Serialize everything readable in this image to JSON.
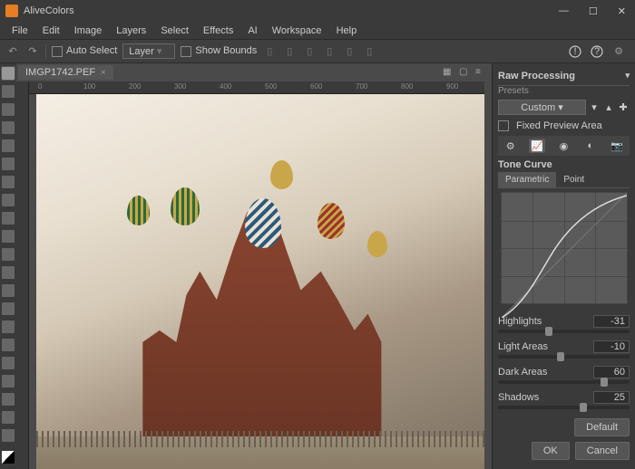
{
  "app": {
    "title": "AliveColors"
  },
  "menu": {
    "items": [
      "File",
      "Edit",
      "Image",
      "Layers",
      "Select",
      "Effects",
      "AI",
      "Workspace",
      "Help"
    ]
  },
  "toolbar": {
    "undo": "↶",
    "redo": "↷",
    "auto_select": "Auto Select",
    "layer_combo": "Layer",
    "show_bounds": "Show Bounds",
    "help": "?",
    "info": "!",
    "settings": "⚙"
  },
  "document": {
    "tab_title": "IMGP1742.PEF"
  },
  "ruler": {
    "marks": [
      "0",
      "100",
      "200",
      "300",
      "400",
      "500",
      "600",
      "700",
      "800",
      "900"
    ]
  },
  "panel": {
    "title": "Raw Processing",
    "presets_label": "Presets",
    "presets_value": "Custom",
    "fixed_preview": "Fixed Preview Area",
    "tone_curve": "Tone Curve",
    "tabs": {
      "parametric": "Parametric",
      "point": "Point"
    },
    "sliders": {
      "highlights": {
        "label": "Highlights",
        "value": "-31",
        "pos": 36
      },
      "light": {
        "label": "Light Areas",
        "value": "-10",
        "pos": 45
      },
      "dark": {
        "label": "Dark Areas",
        "value": "60",
        "pos": 78
      },
      "shadows": {
        "label": "Shadows",
        "value": "25",
        "pos": 62
      }
    },
    "default_btn": "Default",
    "ok": "OK",
    "cancel": "Cancel"
  }
}
